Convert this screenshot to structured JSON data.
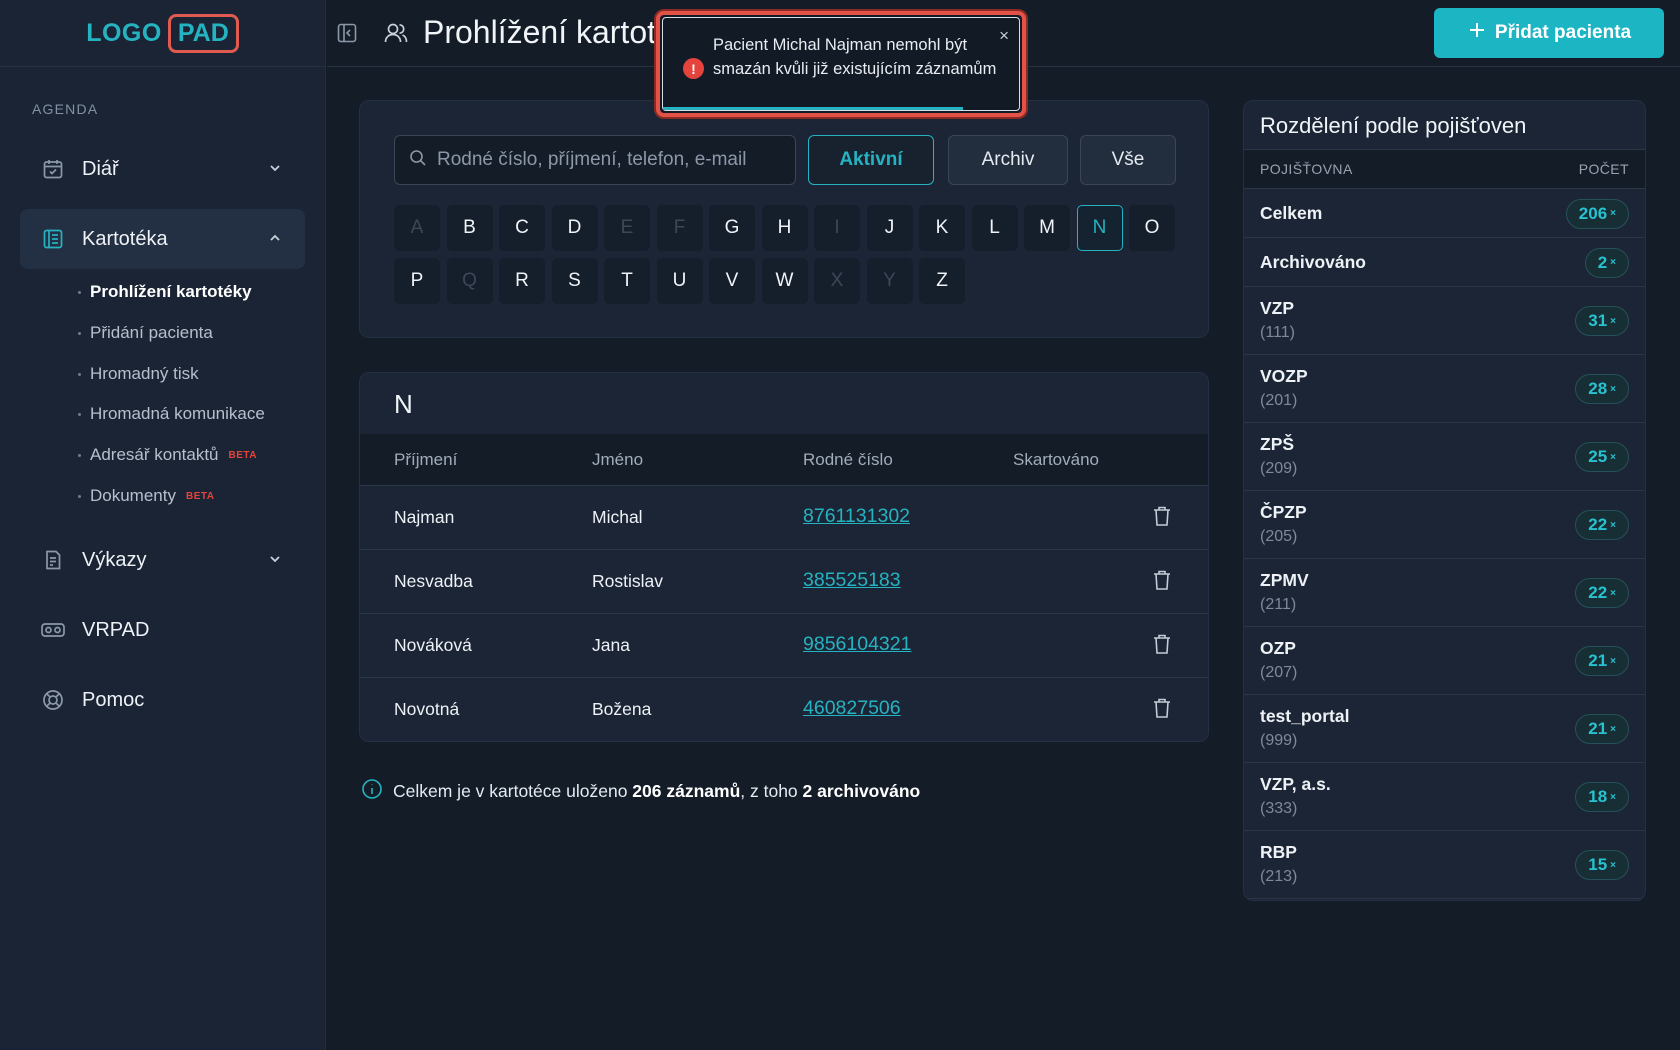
{
  "logo": {
    "part1": "LOGO",
    "part2": "PAD"
  },
  "sidebar": {
    "section_title": "AGENDA",
    "items": [
      {
        "label": "Diář",
        "icon": "calendar-check-icon"
      },
      {
        "label": "Kartotéka",
        "icon": "file-index-icon"
      },
      {
        "label": "Výkazy",
        "icon": "report-icon"
      },
      {
        "label": "VRPAD",
        "icon": "vr-headset-icon"
      },
      {
        "label": "Pomoc",
        "icon": "lifebuoy-icon"
      }
    ],
    "subitems": [
      {
        "label": "Prohlížení kartotéky"
      },
      {
        "label": "Přidání pacienta"
      },
      {
        "label": "Hromadný tisk"
      },
      {
        "label": "Hromadná komunikace"
      },
      {
        "label": "Adresář kontaktů",
        "badge": "BETA"
      },
      {
        "label": "Dokumenty",
        "badge": "BETA"
      }
    ]
  },
  "header": {
    "title": "Prohlížení kartotéky",
    "add_button": "Přidat pacienta"
  },
  "toast": {
    "message": "Pacient Michal Najman nemohl být smazán kvůli již existujícím záznamům",
    "close": "×"
  },
  "filter": {
    "search_placeholder": "Rodné číslo, příjmení, telefon, e-mail",
    "buttons": [
      "Aktivní",
      "Archiv",
      "Vše"
    ],
    "letters_row1": [
      "A",
      "B",
      "C",
      "D",
      "E",
      "F",
      "G",
      "H",
      "I",
      "J",
      "K",
      "L",
      "M",
      "N",
      "O"
    ],
    "letters_row2": [
      "P",
      "Q",
      "R",
      "S",
      "T",
      "U",
      "V",
      "W",
      "X",
      "Y",
      "Z"
    ],
    "disabled_letters": [
      "A",
      "E",
      "F",
      "I",
      "Q",
      "X",
      "Y"
    ],
    "selected_letter": "N"
  },
  "table": {
    "group_letter": "N",
    "columns": [
      "Příjmení",
      "Jméno",
      "Rodné číslo",
      "Skartováno"
    ],
    "rows": [
      {
        "surname": "Najman",
        "name": "Michal",
        "birth_number": "8761131302"
      },
      {
        "surname": "Nesvadba",
        "name": "Rostislav",
        "birth_number": "385525183"
      },
      {
        "surname": "Nováková",
        "name": "Jana",
        "birth_number": "9856104321"
      },
      {
        "surname": "Novotná",
        "name": "Božena",
        "birth_number": "460827506"
      }
    ]
  },
  "info": {
    "prefix": "Celkem je v kartotéce uloženo ",
    "count": "206 záznamů",
    "middle": ", z toho ",
    "archived": "2 archivováno"
  },
  "insurance": {
    "title": "Rozdělení podle pojišťoven",
    "col_name": "POJIŠŤOVNA",
    "col_count": "POČET",
    "rows": [
      {
        "name": "Celkem",
        "code": "",
        "count": "206"
      },
      {
        "name": "Archivováno",
        "code": "",
        "count": "2"
      },
      {
        "name": "VZP",
        "code": "(111)",
        "count": "31"
      },
      {
        "name": "VOZP",
        "code": "(201)",
        "count": "28"
      },
      {
        "name": "ZPŠ",
        "code": "(209)",
        "count": "25"
      },
      {
        "name": "ČPZP",
        "code": "(205)",
        "count": "22"
      },
      {
        "name": "ZPMV",
        "code": "(211)",
        "count": "22"
      },
      {
        "name": "OZP",
        "code": "(207)",
        "count": "21"
      },
      {
        "name": "test_portal",
        "code": "(999)",
        "count": "21"
      },
      {
        "name": "VZP, a.s.",
        "code": "(333)",
        "count": "18"
      },
      {
        "name": "RBP",
        "code": "(213)",
        "count": "15"
      }
    ],
    "times_suffix": "×"
  },
  "colors": {
    "accent": "#1bb5c4",
    "error": "#e25247",
    "background": "#141c28",
    "panel": "#1b2535"
  }
}
